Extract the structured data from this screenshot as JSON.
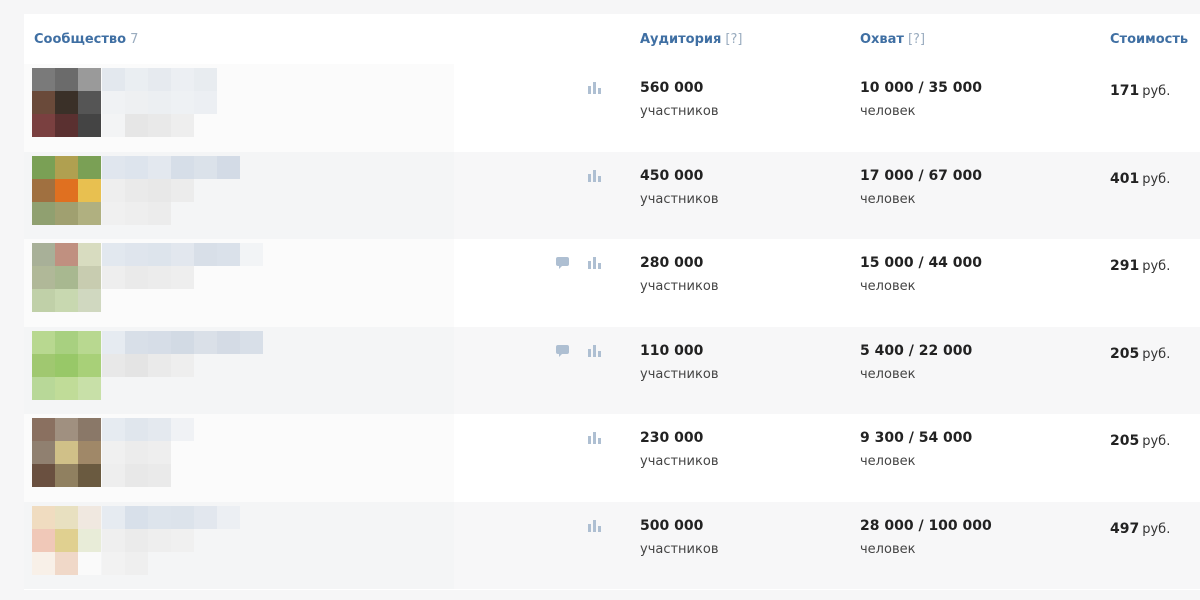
{
  "header": {
    "community_label": "Сообщество",
    "community_count": "7",
    "audience_label": "Аудитория",
    "reach_label": "Охват",
    "cost_label": "Стоимость",
    "hint": "[?]"
  },
  "rows": [
    {
      "audience": "560 000",
      "audience_unit": "участников",
      "reach": "10 000 / 35 000",
      "reach_unit": "человек",
      "cost": "171",
      "cost_unit": "руб.",
      "has_message": false,
      "avatar": [
        "#7a7a7a",
        "#6b6b6b",
        "#9a9a9a",
        "#6a4a3a",
        "#3a3028",
        "#555555",
        "#7a4040",
        "#5a3030",
        "#444444"
      ],
      "name": [
        "#e3e8ee",
        "#eaeef2",
        "#e6eaef",
        "#eceff3",
        "#e8ecf0",
        "",
        "",
        "#f0f2f4",
        "#eef0f2",
        "#eceff2",
        "#eef1f4",
        "#eceff3",
        "",
        "",
        "#f3f4f5",
        "#e6e6e6",
        "#e9e9e9",
        "#eeeeee",
        "",
        "",
        ""
      ]
    },
    {
      "audience": "450 000",
      "audience_unit": "участников",
      "reach": "17 000 / 67 000",
      "reach_unit": "человек",
      "cost": "401",
      "cost_unit": "руб.",
      "has_message": false,
      "avatar": [
        "#7aa055",
        "#b0a050",
        "#7aa055",
        "#a07040",
        "#e07020",
        "#e8c050",
        "#90a070",
        "#a0a070",
        "#b0b080"
      ],
      "name": [
        "#e0e6ee",
        "#dde4ed",
        "#e3e8ef",
        "#d6dee8",
        "#dbe2ea",
        "#d3dbe6",
        "",
        "#eeeeee",
        "#eaeaea",
        "#e8e8e8",
        "#ececec",
        "",
        "",
        "",
        "#f0f0f0",
        "#eeeeee",
        "#ececec",
        "",
        "",
        "",
        ""
      ]
    },
    {
      "audience": "280 000",
      "audience_unit": "участников",
      "reach": "15 000 / 44 000",
      "reach_unit": "человек",
      "cost": "291",
      "cost_unit": "руб.",
      "has_message": true,
      "avatar": [
        "#a8b098",
        "#c09080",
        "#d8dcc0",
        "#b0b898",
        "#a8b890",
        "#c8ccb0",
        "#c0d0a8",
        "#c8d8b0",
        "#d0d8c0"
      ],
      "name": [
        "#e2e8ef",
        "#dfe5ed",
        "#dde4ec",
        "#e2e7ee",
        "#d8dfe8",
        "#dae1ea",
        "#f2f4f6",
        "#eeeeee",
        "#eaeaea",
        "#ececec",
        "#eeeeee",
        "",
        "",
        "",
        "",
        "",
        "",
        "",
        "",
        "",
        ""
      ]
    },
    {
      "audience": "110 000",
      "audience_unit": "участников",
      "reach": "5 400 / 22 000",
      "reach_unit": "человек",
      "cost": "205",
      "cost_unit": "руб.",
      "has_message": true,
      "avatar": [
        "#b8d890",
        "#a8d080",
        "#b8d890",
        "#a0c870",
        "#98c868",
        "#a8d078",
        "#b8d898",
        "#c0dc98",
        "#c8e0a8"
      ],
      "name": [
        "#e6ebf1",
        "#d8dfe8",
        "#d6dde7",
        "#d2dae4",
        "#dae0e8",
        "#d4dbe5",
        "#d8dfe8",
        "#e8e8e8",
        "#e4e4e4",
        "#eaeaea",
        "#eeeeee",
        "",
        "",
        "",
        "",
        "",
        "",
        "",
        "",
        "",
        ""
      ]
    },
    {
      "audience": "230 000",
      "audience_unit": "участников",
      "reach": "9 300 / 54 000",
      "reach_unit": "человек",
      "cost": "205",
      "cost_unit": "руб.",
      "has_message": false,
      "avatar": [
        "#8a7060",
        "#a09080",
        "#8a7868",
        "#908070",
        "#d0c088",
        "#a08868",
        "#6a5040",
        "#908060",
        "#6a5a40"
      ],
      "name": [
        "#e6ebf1",
        "#e0e6ed",
        "#e4e9ef",
        "#f0f2f5",
        "",
        "",
        "",
        "#f0f0f0",
        "#ececec",
        "#eeeeee",
        "",
        "",
        "",
        "",
        "#eeeeee",
        "#e8e8e8",
        "#eaeaea",
        "",
        "",
        "",
        ""
      ]
    },
    {
      "audience": "500 000",
      "audience_unit": "участников",
      "reach": "28 000 / 100 000",
      "reach_unit": "человек",
      "cost": "497",
      "cost_unit": "руб.",
      "has_message": false,
      "avatar": [
        "#f0dcc0",
        "#e8e0c0",
        "#f0e8e0",
        "#f0c8b8",
        "#e0d090",
        "#e8ecd8",
        "#f8f0e8",
        "#f0d8c8",
        "#fafafa"
      ],
      "name": [
        "#e6ebf1",
        "#d8e0ea",
        "#dde4ec",
        "#dce3eb",
        "#e2e7ee",
        "#eceff3",
        "",
        "#efefef",
        "#ebebeb",
        "#eeeeee",
        "#f0f0f0",
        "",
        "",
        "",
        "#f2f2f2",
        "#efefef",
        "",
        "",
        "",
        "",
        ""
      ]
    }
  ],
  "icons": {
    "stats": "stats-icon",
    "message": "message-icon"
  },
  "colors": {
    "header": "#3f6fa3",
    "hint": "#9aacbf",
    "icon": "#aebfd2"
  }
}
